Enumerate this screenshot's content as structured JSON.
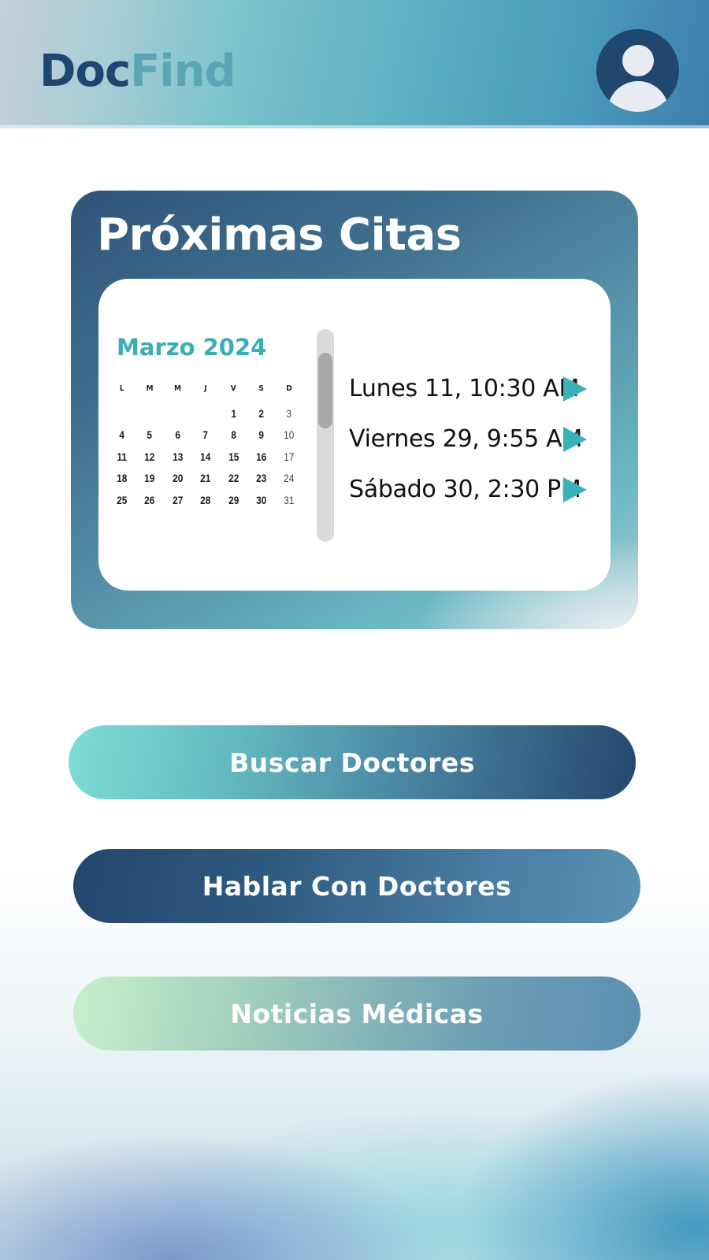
{
  "header": {
    "logo_part1": "Doc",
    "logo_part2": "Find",
    "profile_icon": "user-avatar-icon"
  },
  "appointments_card": {
    "title": "Próximas Citas",
    "calendar": {
      "month_label": "Marzo 2024",
      "weekdays": [
        "L",
        "M",
        "M",
        "J",
        "V",
        "S",
        "D"
      ],
      "weeks": [
        [
          "",
          "",
          "",
          "",
          "1",
          "2",
          "3"
        ],
        [
          "4",
          "5",
          "6",
          "7",
          "8",
          "9",
          "10"
        ],
        [
          "11",
          "12",
          "13",
          "14",
          "15",
          "16",
          "17"
        ],
        [
          "18",
          "19",
          "20",
          "21",
          "22",
          "23",
          "24"
        ],
        [
          "25",
          "26",
          "27",
          "28",
          "29",
          "30",
          "31"
        ]
      ]
    },
    "appointments": [
      {
        "label": "Lunes 11, 10:30 AM",
        "icon": "play-arrow-icon"
      },
      {
        "label": "Viernes 29, 9:55 AM",
        "icon": "play-arrow-icon"
      },
      {
        "label": "Sábado 30, 2:30 PM",
        "icon": "play-arrow-icon"
      }
    ]
  },
  "actions": {
    "search_doctors": "Buscar Doctores",
    "talk_doctors": "Hablar Con Doctores",
    "medical_news": "Noticias Médicas"
  },
  "colors": {
    "brand_dark": "#1e4670",
    "brand_light": "#5aa6b4",
    "accent_teal": "#39b3ba"
  }
}
